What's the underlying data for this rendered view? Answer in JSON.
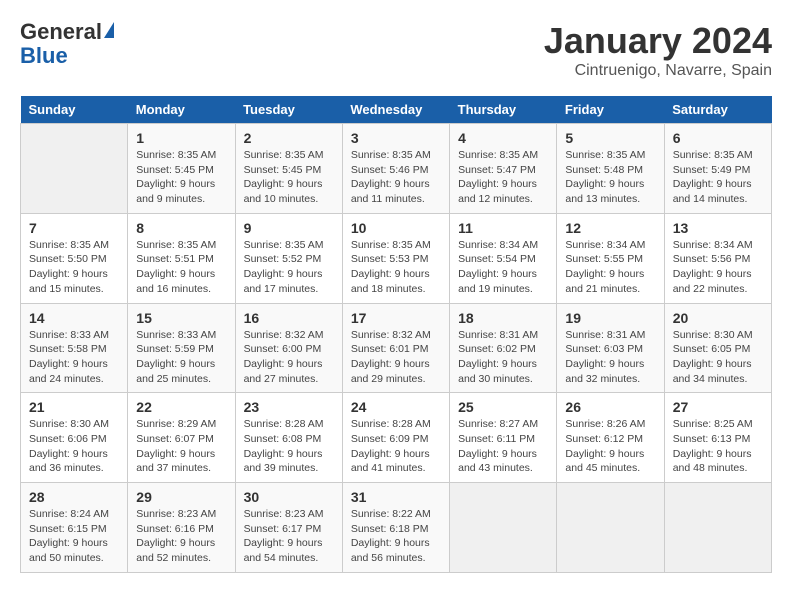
{
  "header": {
    "logo_line1": "General",
    "logo_line2": "Blue",
    "title": "January 2024",
    "subtitle": "Cintruenigo, Navarre, Spain"
  },
  "calendar": {
    "days_of_week": [
      "Sunday",
      "Monday",
      "Tuesday",
      "Wednesday",
      "Thursday",
      "Friday",
      "Saturday"
    ],
    "weeks": [
      [
        {
          "date": "",
          "info": ""
        },
        {
          "date": "1",
          "info": "Sunrise: 8:35 AM\nSunset: 5:45 PM\nDaylight: 9 hours\nand 9 minutes."
        },
        {
          "date": "2",
          "info": "Sunrise: 8:35 AM\nSunset: 5:45 PM\nDaylight: 9 hours\nand 10 minutes."
        },
        {
          "date": "3",
          "info": "Sunrise: 8:35 AM\nSunset: 5:46 PM\nDaylight: 9 hours\nand 11 minutes."
        },
        {
          "date": "4",
          "info": "Sunrise: 8:35 AM\nSunset: 5:47 PM\nDaylight: 9 hours\nand 12 minutes."
        },
        {
          "date": "5",
          "info": "Sunrise: 8:35 AM\nSunset: 5:48 PM\nDaylight: 9 hours\nand 13 minutes."
        },
        {
          "date": "6",
          "info": "Sunrise: 8:35 AM\nSunset: 5:49 PM\nDaylight: 9 hours\nand 14 minutes."
        }
      ],
      [
        {
          "date": "7",
          "info": "Sunrise: 8:35 AM\nSunset: 5:50 PM\nDaylight: 9 hours\nand 15 minutes."
        },
        {
          "date": "8",
          "info": "Sunrise: 8:35 AM\nSunset: 5:51 PM\nDaylight: 9 hours\nand 16 minutes."
        },
        {
          "date": "9",
          "info": "Sunrise: 8:35 AM\nSunset: 5:52 PM\nDaylight: 9 hours\nand 17 minutes."
        },
        {
          "date": "10",
          "info": "Sunrise: 8:35 AM\nSunset: 5:53 PM\nDaylight: 9 hours\nand 18 minutes."
        },
        {
          "date": "11",
          "info": "Sunrise: 8:34 AM\nSunset: 5:54 PM\nDaylight: 9 hours\nand 19 minutes."
        },
        {
          "date": "12",
          "info": "Sunrise: 8:34 AM\nSunset: 5:55 PM\nDaylight: 9 hours\nand 21 minutes."
        },
        {
          "date": "13",
          "info": "Sunrise: 8:34 AM\nSunset: 5:56 PM\nDaylight: 9 hours\nand 22 minutes."
        }
      ],
      [
        {
          "date": "14",
          "info": "Sunrise: 8:33 AM\nSunset: 5:58 PM\nDaylight: 9 hours\nand 24 minutes."
        },
        {
          "date": "15",
          "info": "Sunrise: 8:33 AM\nSunset: 5:59 PM\nDaylight: 9 hours\nand 25 minutes."
        },
        {
          "date": "16",
          "info": "Sunrise: 8:32 AM\nSunset: 6:00 PM\nDaylight: 9 hours\nand 27 minutes."
        },
        {
          "date": "17",
          "info": "Sunrise: 8:32 AM\nSunset: 6:01 PM\nDaylight: 9 hours\nand 29 minutes."
        },
        {
          "date": "18",
          "info": "Sunrise: 8:31 AM\nSunset: 6:02 PM\nDaylight: 9 hours\nand 30 minutes."
        },
        {
          "date": "19",
          "info": "Sunrise: 8:31 AM\nSunset: 6:03 PM\nDaylight: 9 hours\nand 32 minutes."
        },
        {
          "date": "20",
          "info": "Sunrise: 8:30 AM\nSunset: 6:05 PM\nDaylight: 9 hours\nand 34 minutes."
        }
      ],
      [
        {
          "date": "21",
          "info": "Sunrise: 8:30 AM\nSunset: 6:06 PM\nDaylight: 9 hours\nand 36 minutes."
        },
        {
          "date": "22",
          "info": "Sunrise: 8:29 AM\nSunset: 6:07 PM\nDaylight: 9 hours\nand 37 minutes."
        },
        {
          "date": "23",
          "info": "Sunrise: 8:28 AM\nSunset: 6:08 PM\nDaylight: 9 hours\nand 39 minutes."
        },
        {
          "date": "24",
          "info": "Sunrise: 8:28 AM\nSunset: 6:09 PM\nDaylight: 9 hours\nand 41 minutes."
        },
        {
          "date": "25",
          "info": "Sunrise: 8:27 AM\nSunset: 6:11 PM\nDaylight: 9 hours\nand 43 minutes."
        },
        {
          "date": "26",
          "info": "Sunrise: 8:26 AM\nSunset: 6:12 PM\nDaylight: 9 hours\nand 45 minutes."
        },
        {
          "date": "27",
          "info": "Sunrise: 8:25 AM\nSunset: 6:13 PM\nDaylight: 9 hours\nand 48 minutes."
        }
      ],
      [
        {
          "date": "28",
          "info": "Sunrise: 8:24 AM\nSunset: 6:15 PM\nDaylight: 9 hours\nand 50 minutes."
        },
        {
          "date": "29",
          "info": "Sunrise: 8:23 AM\nSunset: 6:16 PM\nDaylight: 9 hours\nand 52 minutes."
        },
        {
          "date": "30",
          "info": "Sunrise: 8:23 AM\nSunset: 6:17 PM\nDaylight: 9 hours\nand 54 minutes."
        },
        {
          "date": "31",
          "info": "Sunrise: 8:22 AM\nSunset: 6:18 PM\nDaylight: 9 hours\nand 56 minutes."
        },
        {
          "date": "",
          "info": ""
        },
        {
          "date": "",
          "info": ""
        },
        {
          "date": "",
          "info": ""
        }
      ]
    ]
  }
}
